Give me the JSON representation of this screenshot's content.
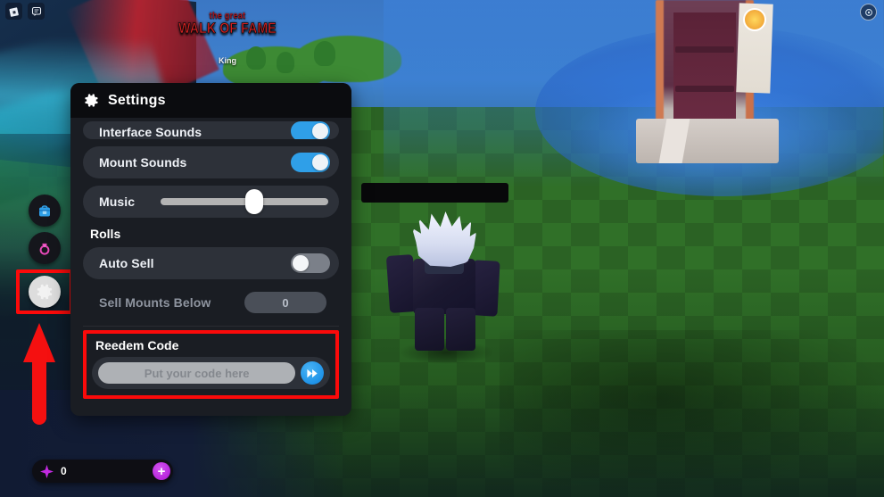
{
  "game": {
    "logo_top": "the great",
    "logo_main": "WALK OF FAME",
    "player_name": "King"
  },
  "hud": {
    "top_left_icons": [
      "roblox-logo-icon",
      "chat-icon"
    ],
    "top_right_icon": "camera-icon"
  },
  "sidebar": {
    "items": [
      {
        "name": "inventory",
        "icon": "backpack-icon",
        "active": false
      },
      {
        "name": "rings",
        "icon": "ring-icon",
        "active": false
      },
      {
        "name": "settings",
        "icon": "gear-icon",
        "active": true
      }
    ]
  },
  "annotations": {
    "arrow": "red-up-arrow",
    "gear_highlight_color": "#fb0a0a",
    "redeem_highlight_color": "#fb0a0a"
  },
  "currency": {
    "icon": "sparkle-icon",
    "amount": "0",
    "add_label": "+"
  },
  "panel": {
    "title": "Settings",
    "title_icon": "gear-icon",
    "rows": [
      {
        "label": "Interface Sounds",
        "control": "toggle",
        "value": "on",
        "clipped": true
      },
      {
        "label": "Mount Sounds",
        "control": "toggle",
        "value": "on"
      },
      {
        "label": "Music",
        "control": "slider",
        "value": 56
      }
    ],
    "section": {
      "label": "Rolls",
      "rows": [
        {
          "label": "Auto Sell",
          "control": "toggle",
          "value": "off"
        },
        {
          "label": "Sell Mounts Below",
          "control": "number",
          "value": "0",
          "disabled": true
        }
      ]
    },
    "redeem": {
      "label": "Reedem Code",
      "placeholder": "Put your code here",
      "input_value": "",
      "submit_icon": "fast-forward-icon"
    }
  },
  "colors": {
    "toggle_on": "#2f9fe8",
    "toggle_off": "#7b8089",
    "panel_bg": "#1a1d23",
    "row_bg": "#2d3139",
    "header_bg": "#0b0c0f",
    "accent_red": "#fb0a0a",
    "currency_purple": "#b726dd"
  }
}
